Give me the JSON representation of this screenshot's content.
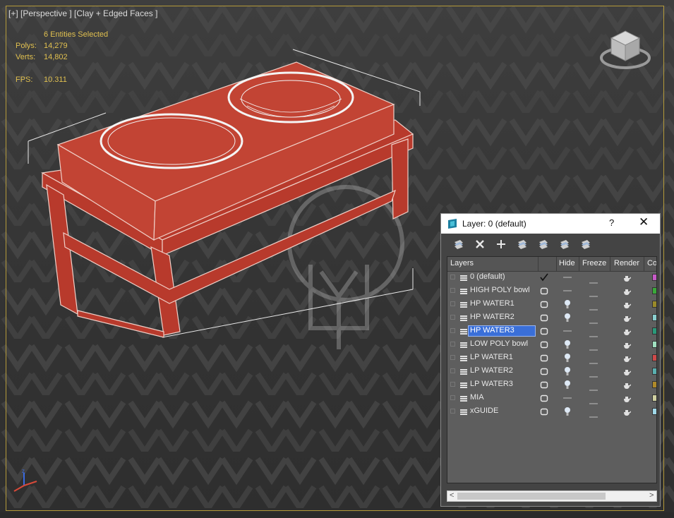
{
  "viewport": {
    "label": "[+] [Perspective ] [Clay + Edged Faces ]",
    "selection": "6 Entities Selected",
    "polys_label": "Polys:",
    "polys_value": "14,279",
    "verts_label": "Verts:",
    "verts_value": "14,802",
    "fps_label": "FPS:",
    "fps_value": "10.311",
    "navcube_icon": "view-cube-icon",
    "axis_icon": "world-axis-icon"
  },
  "layer_dialog": {
    "title": "Layer: 0 (default)",
    "help": "?",
    "close": "✕",
    "toolbar": [
      {
        "icon": "create-layer-icon"
      },
      {
        "icon": "delete-layer-icon"
      },
      {
        "icon": "add-to-layer-icon"
      },
      {
        "icon": "select-objects-icon"
      },
      {
        "icon": "highlight-layer-icon"
      },
      {
        "icon": "hide-all-layers-icon"
      },
      {
        "icon": "freeze-all-layers-icon"
      }
    ],
    "columns": [
      "Layers",
      "Hide",
      "Freeze",
      "Render",
      "Co"
    ],
    "rows": [
      {
        "name": "0 (default)",
        "active": true,
        "hidden": false,
        "color": "#c85ac8"
      },
      {
        "name": "HIGH POLY bowl",
        "active": false,
        "hidden": false,
        "color": "#3aaa3a"
      },
      {
        "name": "HP WATER1",
        "active": false,
        "hidden": true,
        "color": "#9a8a2a"
      },
      {
        "name": "HP WATER2",
        "active": false,
        "hidden": true,
        "color": "#8ad0d0"
      },
      {
        "name": "HP WATER3",
        "active": false,
        "hidden": false,
        "selected": true,
        "color": "#2a9a7a"
      },
      {
        "name": "LOW POLY bowl",
        "active": false,
        "hidden": true,
        "color": "#a0e0c0"
      },
      {
        "name": "LP WATER1",
        "active": false,
        "hidden": true,
        "color": "#d04a4a"
      },
      {
        "name": "LP WATER2",
        "active": false,
        "hidden": true,
        "color": "#5ab0b0"
      },
      {
        "name": "LP WATER3",
        "active": false,
        "hidden": true,
        "color": "#b08a2a"
      },
      {
        "name": "MIA",
        "active": false,
        "hidden": false,
        "color": "#d0d0a0"
      },
      {
        "name": "xGUIDE",
        "active": false,
        "hidden": true,
        "color": "#a0d8e8"
      }
    ],
    "scroll_left": "<",
    "scroll_right": ">"
  },
  "colors": {
    "model_red": "#b83a2c",
    "stats_yellow": "#e0c050",
    "selection_blue": "#3a6fd8"
  }
}
